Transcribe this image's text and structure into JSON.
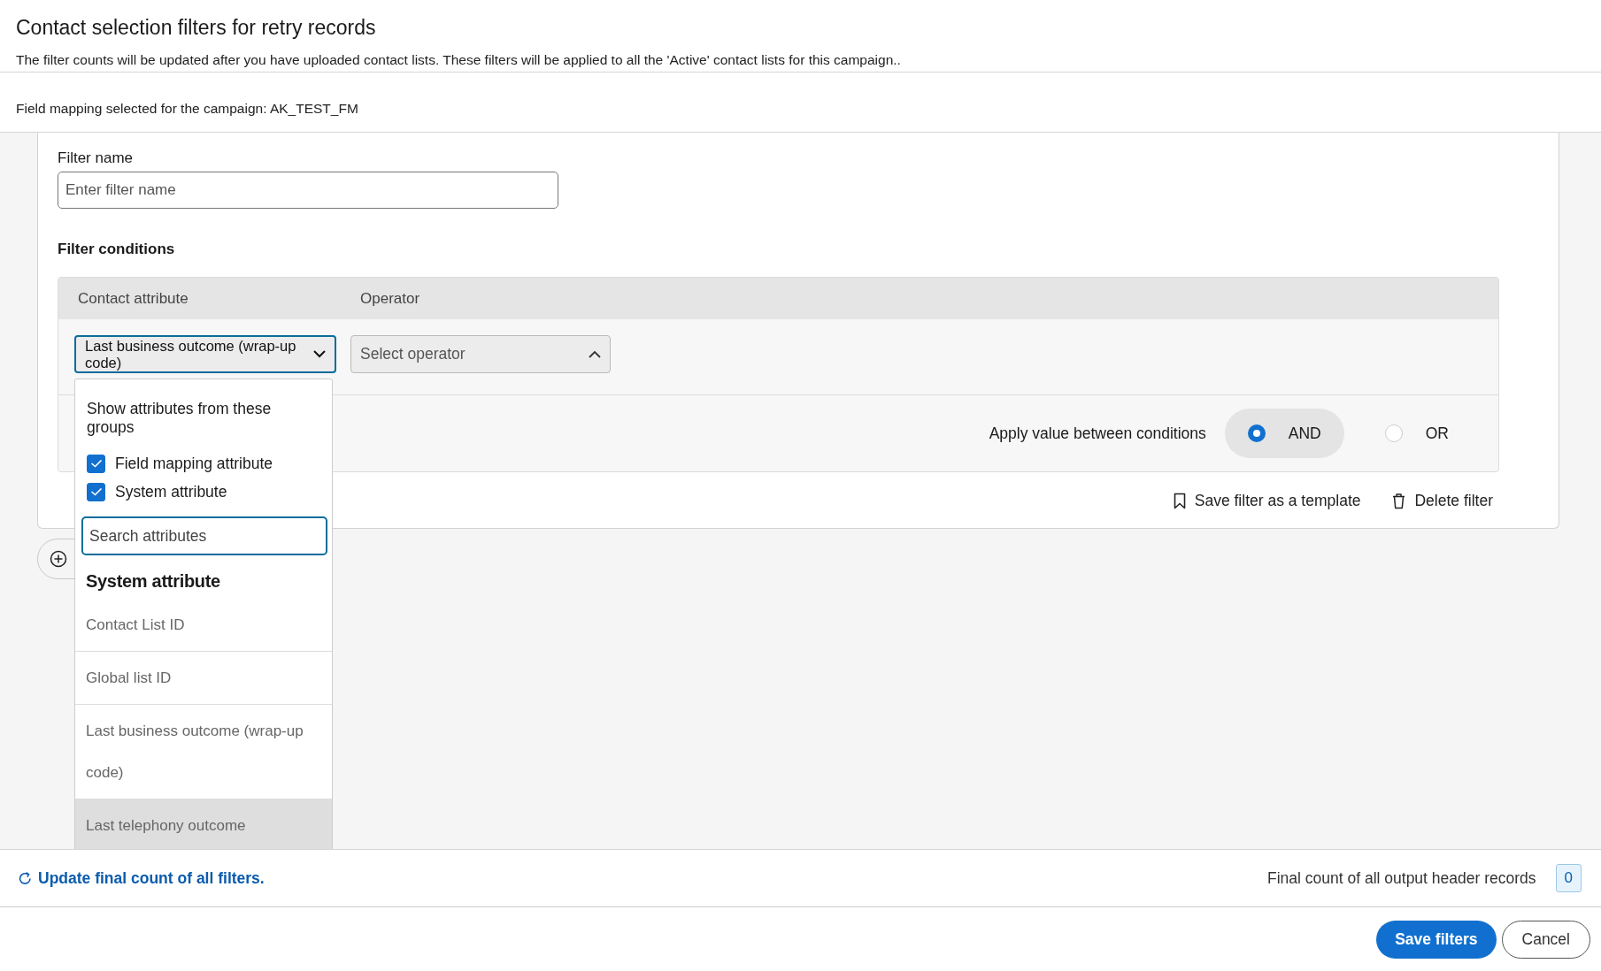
{
  "header": {
    "title": "Contact selection filters for retry records",
    "description": "The filter counts will be updated after you have uploaded contact lists. These filters will be applied to all the 'Active' contact lists for this campaign.."
  },
  "field_mapping": "Field mapping selected for the campaign: AK_TEST_FM",
  "filter_name": {
    "label": "Filter name",
    "placeholder": "Enter filter name"
  },
  "conditions": {
    "title": "Filter conditions",
    "columns": [
      "Contact attribute",
      "Operator"
    ],
    "attribute": {
      "value": "Last business outcome (wrap-up code)",
      "focused": true
    },
    "operator": {
      "placeholder": "Select operator",
      "expanded": true
    }
  },
  "combine": {
    "label": "Apply value between conditions",
    "options": [
      {
        "label": "AND",
        "selected": true
      },
      {
        "label": "OR",
        "selected": false
      }
    ]
  },
  "actions": [
    {
      "label": "Save filter as a template",
      "kind": "template"
    },
    {
      "label": "Delete filter",
      "kind": "delete"
    }
  ],
  "dropdown": {
    "heading": "Show attributes from these groups",
    "groups": [
      {
        "label": "Field mapping attribute",
        "checked": true
      },
      {
        "label": "System attribute",
        "checked": true
      }
    ],
    "search": {
      "placeholder": "Search attributes"
    },
    "section_title": "System attribute",
    "items": [
      {
        "label": "Contact List ID",
        "highlighted": false
      },
      {
        "label": "Global list ID",
        "highlighted": false
      },
      {
        "label": "Last business outcome (wrap-up code)",
        "highlighted": false
      },
      {
        "label": "Last telephony outcome",
        "highlighted": true
      }
    ]
  },
  "footer": {
    "update_link": "Update final count of all filters.",
    "count_label": "Final count of all output header records",
    "count": "0"
  },
  "buttons": [
    {
      "label": "Save filters",
      "kind": "primary"
    },
    {
      "label": "Cancel",
      "kind": "secondary"
    }
  ]
}
